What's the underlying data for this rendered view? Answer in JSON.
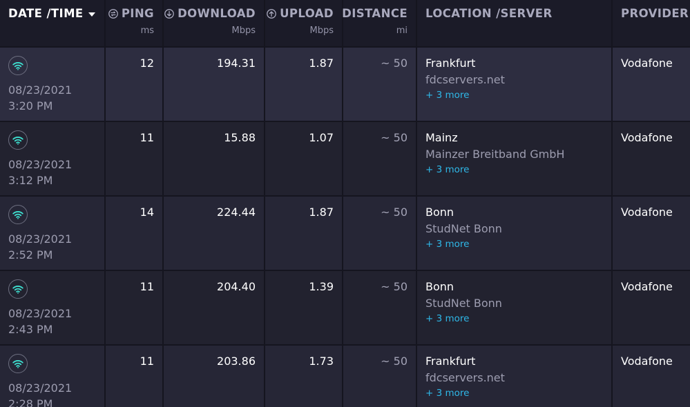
{
  "header": {
    "date_time": "DATE /TIME",
    "ping": "PING",
    "ping_unit": "ms",
    "download": "DOWNLOAD",
    "download_unit": "Mbps",
    "upload": "UPLOAD",
    "upload_unit": "Mbps",
    "distance": "DISTANCE",
    "distance_unit": "mi",
    "location": "LOCATION /SERVER",
    "provider": "PROVIDER"
  },
  "rows": [
    {
      "date": "08/23/2021",
      "time": "3:20 PM",
      "ping": "12",
      "download": "194.31",
      "upload": "1.87",
      "distance": "~ 50",
      "city": "Frankfurt",
      "server": "fdcservers.net",
      "more": "+ 3 more",
      "provider": "Vodafone"
    },
    {
      "date": "08/23/2021",
      "time": "3:12 PM",
      "ping": "11",
      "download": "15.88",
      "upload": "1.07",
      "distance": "~ 50",
      "city": "Mainz",
      "server": "Mainzer Breitband GmbH",
      "more": "+ 3 more",
      "provider": "Vodafone"
    },
    {
      "date": "08/23/2021",
      "time": "2:52 PM",
      "ping": "14",
      "download": "224.44",
      "upload": "1.87",
      "distance": "~ 50",
      "city": "Bonn",
      "server": "StudNet Bonn",
      "more": "+ 3 more",
      "provider": "Vodafone"
    },
    {
      "date": "08/23/2021",
      "time": "2:43 PM",
      "ping": "11",
      "download": "204.40",
      "upload": "1.39",
      "distance": "~ 50",
      "city": "Bonn",
      "server": "StudNet Bonn",
      "more": "+ 3 more",
      "provider": "Vodafone"
    },
    {
      "date": "08/23/2021",
      "time": "2:28 PM",
      "ping": "11",
      "download": "203.86",
      "upload": "1.73",
      "distance": "~ 50",
      "city": "Frankfurt",
      "server": "fdcservers.net",
      "more": "+ 3 more",
      "provider": "Vodafone"
    }
  ],
  "icons": {
    "connection": "wifi-icon",
    "ping": "ping-icon",
    "download": "download-icon",
    "upload": "upload-icon",
    "sort": "caret-down-icon"
  },
  "colors": {
    "accent_link": "#2fb8e8",
    "wifi": "#3ee0d0"
  }
}
